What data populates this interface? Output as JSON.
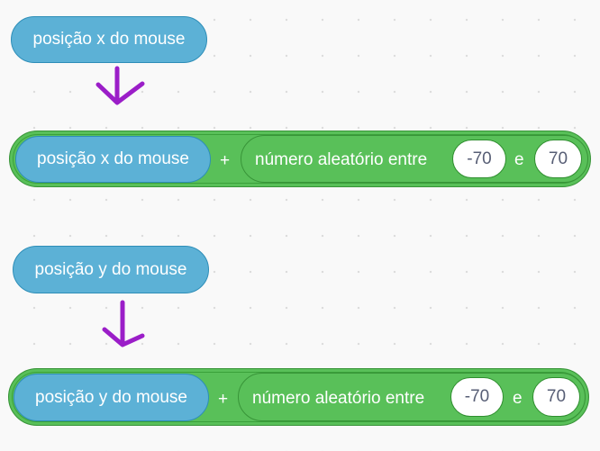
{
  "blocks": {
    "mouse_x_label": "posição x do mouse",
    "mouse_y_label": "posição y do mouse",
    "plus_symbol": "+",
    "random_label": "número aleatório entre",
    "and_label": "e",
    "x_random_from": "-70",
    "x_random_to": "70",
    "y_random_from": "-70",
    "y_random_to": "70"
  },
  "colors": {
    "sensing_block": "#5cb1d6",
    "operator_block": "#59c059",
    "arrow": "#9b1ec8"
  }
}
